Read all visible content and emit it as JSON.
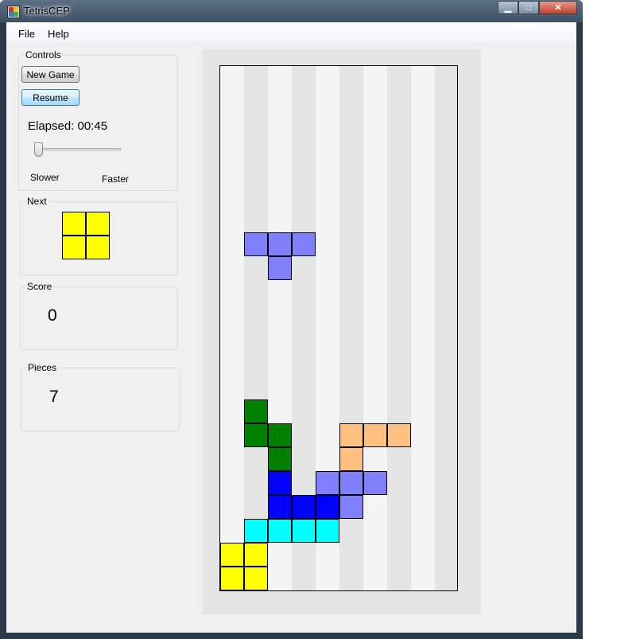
{
  "window": {
    "title": "TetrisCEP",
    "min_glyph": "▁",
    "max_glyph": "□",
    "close_glyph": "✕"
  },
  "menu": [
    "File",
    "Help"
  ],
  "controls": {
    "group_title": "Controls",
    "new_game_label": "New Game",
    "resume_label": "Resume",
    "elapsed_text": "Elapsed: 00:45",
    "speed_level": 0,
    "slower_label": "Slower",
    "faster_label": "Faster"
  },
  "next": {
    "group_title": "Next",
    "piece": "O",
    "color": "#ffff00"
  },
  "score": {
    "group_title": "Score",
    "value": "0"
  },
  "pieces": {
    "group_title": "Pieces",
    "value": "7"
  },
  "board": {
    "columns": 10,
    "rows": 22,
    "active_piece": {
      "type": "T",
      "color": "#8080ff",
      "cells": [
        [
          1,
          7
        ],
        [
          2,
          7
        ],
        [
          3,
          7
        ],
        [
          2,
          8
        ]
      ]
    },
    "settled": [
      {
        "col": 1,
        "row": 14,
        "color": "#008000"
      },
      {
        "col": 1,
        "row": 15,
        "color": "#008000"
      },
      {
        "col": 2,
        "row": 15,
        "color": "#008000"
      },
      {
        "col": 2,
        "row": 16,
        "color": "#008000"
      },
      {
        "col": 5,
        "row": 15,
        "color": "#ffc080"
      },
      {
        "col": 6,
        "row": 15,
        "color": "#ffc080"
      },
      {
        "col": 7,
        "row": 15,
        "color": "#ffc080"
      },
      {
        "col": 5,
        "row": 16,
        "color": "#ffc080"
      },
      {
        "col": 2,
        "row": 17,
        "color": "#0000ff"
      },
      {
        "col": 2,
        "row": 18,
        "color": "#0000ff"
      },
      {
        "col": 3,
        "row": 18,
        "color": "#0000ff"
      },
      {
        "col": 4,
        "row": 18,
        "color": "#0000ff"
      },
      {
        "col": 4,
        "row": 17,
        "color": "#8080ff"
      },
      {
        "col": 5,
        "row": 17,
        "color": "#8080ff"
      },
      {
        "col": 6,
        "row": 17,
        "color": "#8080ff"
      },
      {
        "col": 5,
        "row": 18,
        "color": "#8080ff"
      },
      {
        "col": 1,
        "row": 19,
        "color": "#00ffff"
      },
      {
        "col": 2,
        "row": 19,
        "color": "#00ffff"
      },
      {
        "col": 3,
        "row": 19,
        "color": "#00ffff"
      },
      {
        "col": 4,
        "row": 19,
        "color": "#00ffff"
      },
      {
        "col": 0,
        "row": 20,
        "color": "#ffff00"
      },
      {
        "col": 1,
        "row": 20,
        "color": "#ffff00"
      },
      {
        "col": 0,
        "row": 21,
        "color": "#ffff00"
      },
      {
        "col": 1,
        "row": 21,
        "color": "#ffff00"
      }
    ]
  }
}
